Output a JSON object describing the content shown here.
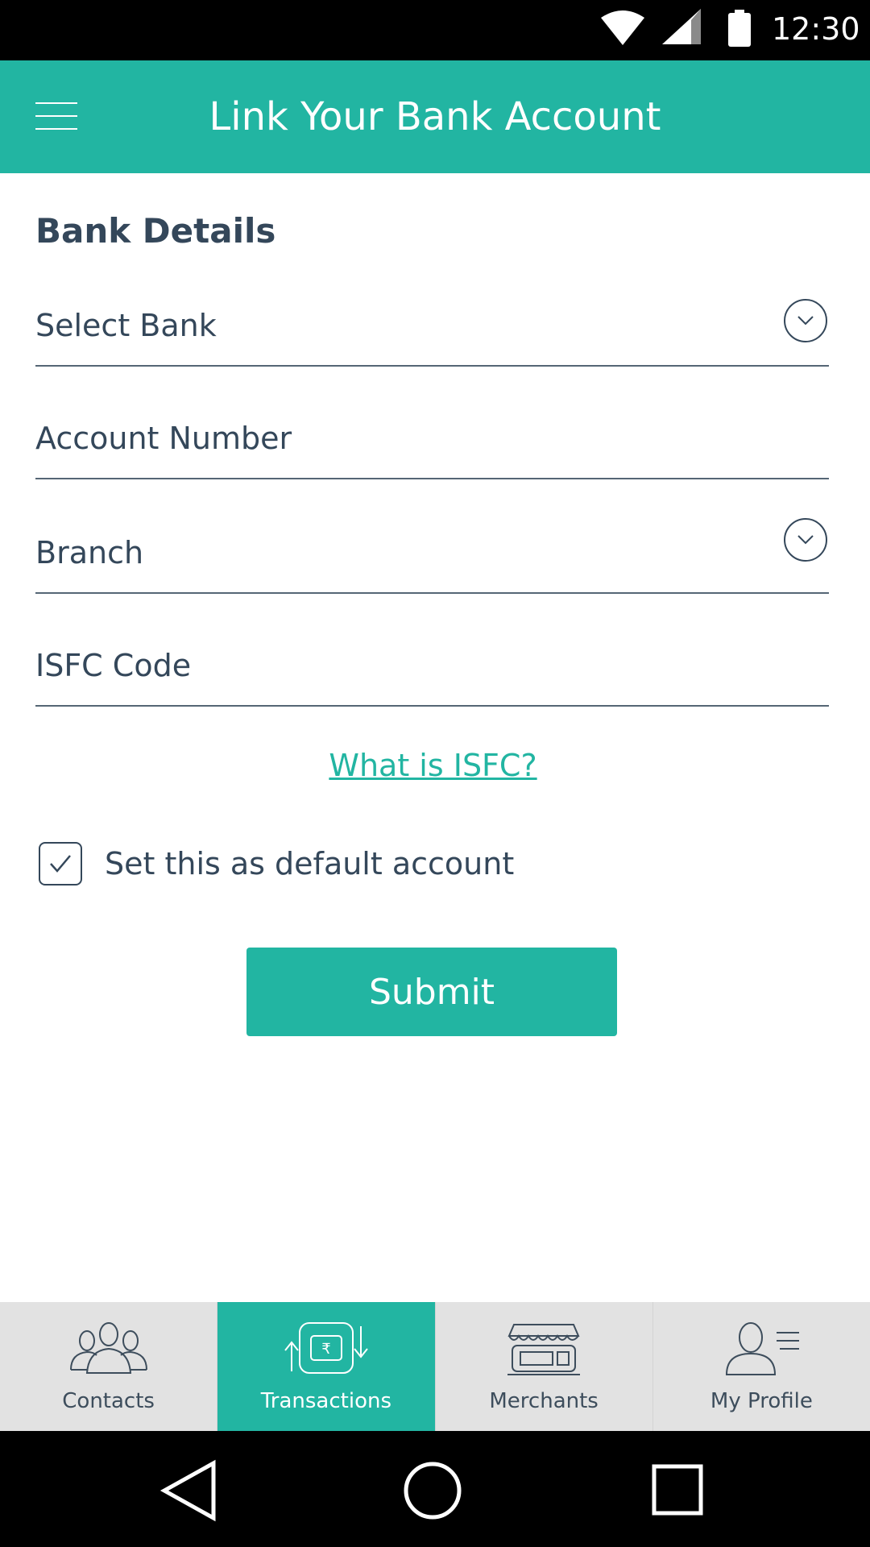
{
  "status_bar": {
    "time": "12:30",
    "icons": [
      "wifi-icon",
      "cellular-signal-icon",
      "battery-icon"
    ]
  },
  "app_bar": {
    "menu_icon": "hamburger-menu-icon",
    "title": "Link Your Bank Account"
  },
  "form": {
    "section_title": "Bank Details",
    "fields": {
      "bank": {
        "placeholder": "Select Bank",
        "value": "",
        "icon": "chevron-down-circle-icon"
      },
      "account_number": {
        "placeholder": "Account Number",
        "value": ""
      },
      "branch": {
        "placeholder": "Branch",
        "value": "",
        "icon": "chevron-down-circle-icon"
      },
      "isfc_code": {
        "placeholder": "ISFC Code",
        "value": ""
      }
    },
    "isfc_help_link": "What is ISFC?",
    "default_account": {
      "label": "Set this as default account",
      "checked": true
    },
    "submit_label": "Submit"
  },
  "bottom_nav": {
    "active": "Transactions",
    "items": [
      {
        "label": "Contacts",
        "icon": "contacts-icon"
      },
      {
        "label": "Transactions",
        "icon": "transactions-rupee-icon"
      },
      {
        "label": "Merchants",
        "icon": "merchant-store-icon"
      },
      {
        "label": "My Profile",
        "icon": "profile-icon"
      }
    ]
  },
  "system_nav": {
    "icons": [
      "back-icon",
      "home-icon",
      "recent-apps-icon"
    ]
  },
  "colors": {
    "accent": "#22b5a2",
    "text": "#34475a",
    "nav_background": "#e2e2e2"
  }
}
